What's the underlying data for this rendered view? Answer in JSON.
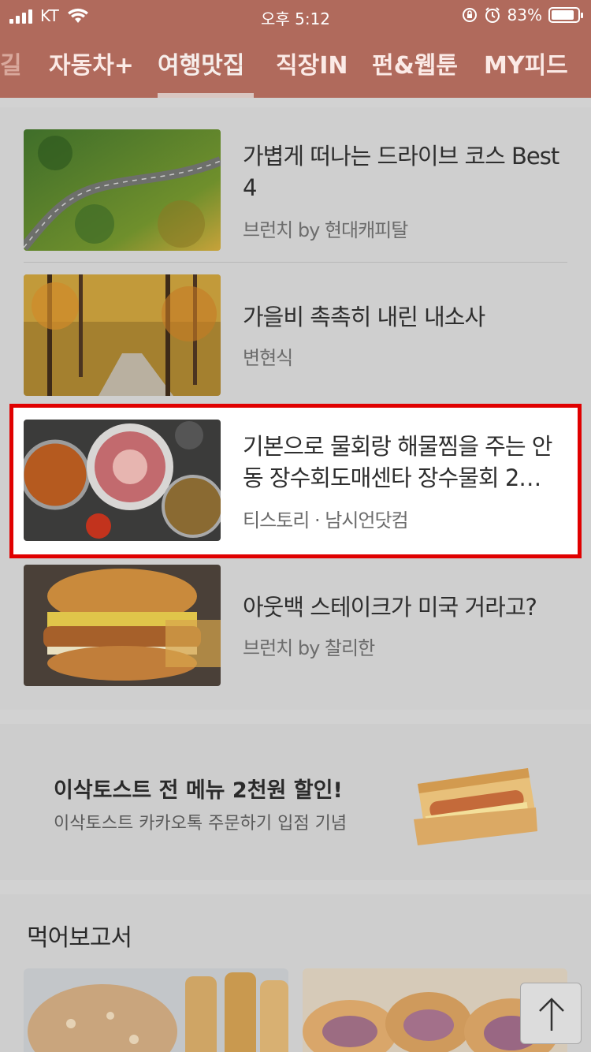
{
  "status_bar": {
    "carrier": "KT",
    "time": "오후 5:12",
    "battery": "83%"
  },
  "tabs": [
    {
      "label": "길"
    },
    {
      "label": "자동차+"
    },
    {
      "label": "여행맛집"
    },
    {
      "label": "직장IN"
    },
    {
      "label": "펀&웹툰"
    },
    {
      "label": "MY피드"
    }
  ],
  "active_tab": "여행맛집",
  "articles": [
    {
      "title_line1": "가볍게 떠나는 드라이브 코스 Best",
      "title_line2": "4",
      "source": "브런치 by 현대캐피탈"
    },
    {
      "title_line1": "가을비 촉촉히 내린 내소사",
      "title_line2": "",
      "source": "변현식"
    },
    {
      "title_line1": "기본으로 물회랑 해물찜을 주는 안",
      "title_line2": "동 장수회도매센타 장수물회 2…",
      "source": "티스토리 · 남시언닷컴"
    },
    {
      "title_line1": "아웃백 스테이크가 미국 거라고?",
      "title_line2": "",
      "source": "브런치 by 찰리한"
    }
  ],
  "ad": {
    "title": "이삭토스트 전 메뉴 2천원 할인!",
    "subtitle": "이삭토스트 카카오톡 주문하기 입점 기념"
  },
  "section2": {
    "title": "먹어보고서"
  },
  "colors": {
    "header": "#b06a5c",
    "highlight_border": "#e00000"
  }
}
